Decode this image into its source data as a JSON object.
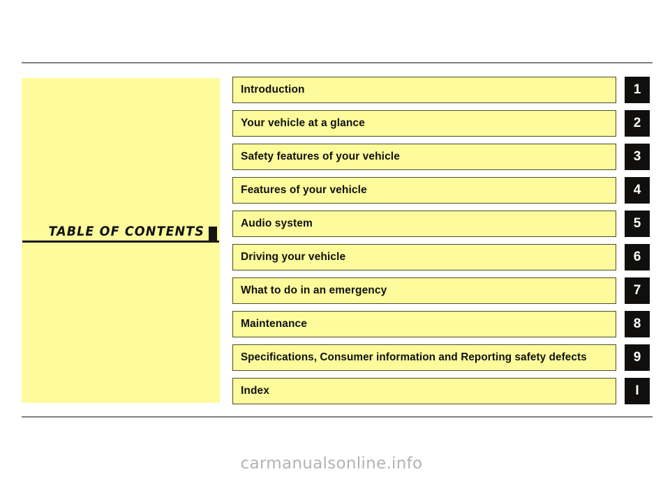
{
  "page": {
    "title": "TABLE  OF  CONTENTS",
    "background_color": "#ffffff",
    "panel_color": "#fdfb9b",
    "rule_color": "#7f7f7f",
    "tab_color": "#100f0d",
    "tab_text_color": "#ffffff"
  },
  "contents": [
    {
      "label": "Introduction",
      "tab": "1"
    },
    {
      "label": "Your vehicle at a glance",
      "tab": "2"
    },
    {
      "label": "Safety features of your vehicle",
      "tab": "3"
    },
    {
      "label": "Features of your vehicle",
      "tab": "4"
    },
    {
      "label": "Audio system",
      "tab": "5"
    },
    {
      "label": "Driving your vehicle",
      "tab": "6"
    },
    {
      "label": "What to do in an emergency",
      "tab": "7"
    },
    {
      "label": "Maintenance",
      "tab": "8"
    },
    {
      "label": "Specifications, Consumer information and Reporting safety defects",
      "tab": "9"
    },
    {
      "label": "Index",
      "tab": "I"
    }
  ],
  "watermark": {
    "text": "carmanualsonline.info"
  }
}
